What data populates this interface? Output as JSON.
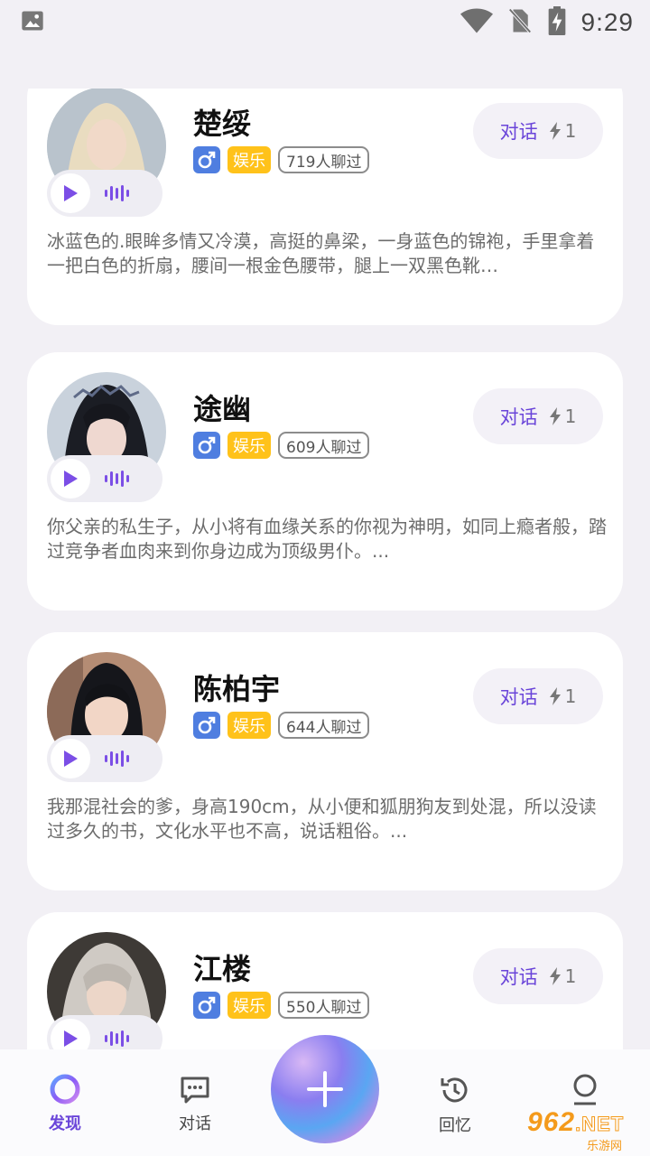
{
  "status_bar": {
    "time": "9:29",
    "icons": [
      "image-icon",
      "wifi-icon",
      "no-sim-icon",
      "battery-charging-icon"
    ]
  },
  "cards": [
    {
      "name": "楚绥",
      "gender_symbol": "♂",
      "tag": "娱乐",
      "chat_count": "719人聊过",
      "chat_label": "对话",
      "energy": "1",
      "description": "冰蓝色的.眼眸多情又冷漠，高挺的鼻梁，一身蓝色的锦袍，手里拿着一把白色的折扇，腰间一根金色腰带，腿上一双黑色靴…"
    },
    {
      "name": "途幽",
      "gender_symbol": "♂",
      "tag": "娱乐",
      "chat_count": "609人聊过",
      "chat_label": "对话",
      "energy": "1",
      "description": "你父亲的私生子，从小将有血缘关系的你视为神明，如同上瘾者般，踏过竞争者血肉来到你身边成为顶级男仆。..."
    },
    {
      "name": "陈柏宇",
      "gender_symbol": "♂",
      "tag": "娱乐",
      "chat_count": "644人聊过",
      "chat_label": "对话",
      "energy": "1",
      "description": "我那混社会的爹，身高190cm，从小便和狐朋狗友到处混，所以没读过多久的书，文化水平也不高，说话粗俗。..."
    },
    {
      "name": "江楼",
      "gender_symbol": "♂",
      "tag": "娱乐",
      "chat_count": "550人聊过",
      "chat_label": "对话",
      "energy": "1",
      "description": ""
    }
  ],
  "nav": {
    "discover": "发现",
    "chat": "对话",
    "memory": "回忆",
    "profile": ""
  },
  "watermark": {
    "num": "962",
    "net": ".NET",
    "sub": "乐游网"
  },
  "colors": {
    "accent": "#6a45d9",
    "tag_yellow": "#ffc21a",
    "gender_blue": "#4f7ee0",
    "background": "#f2f0f5"
  }
}
